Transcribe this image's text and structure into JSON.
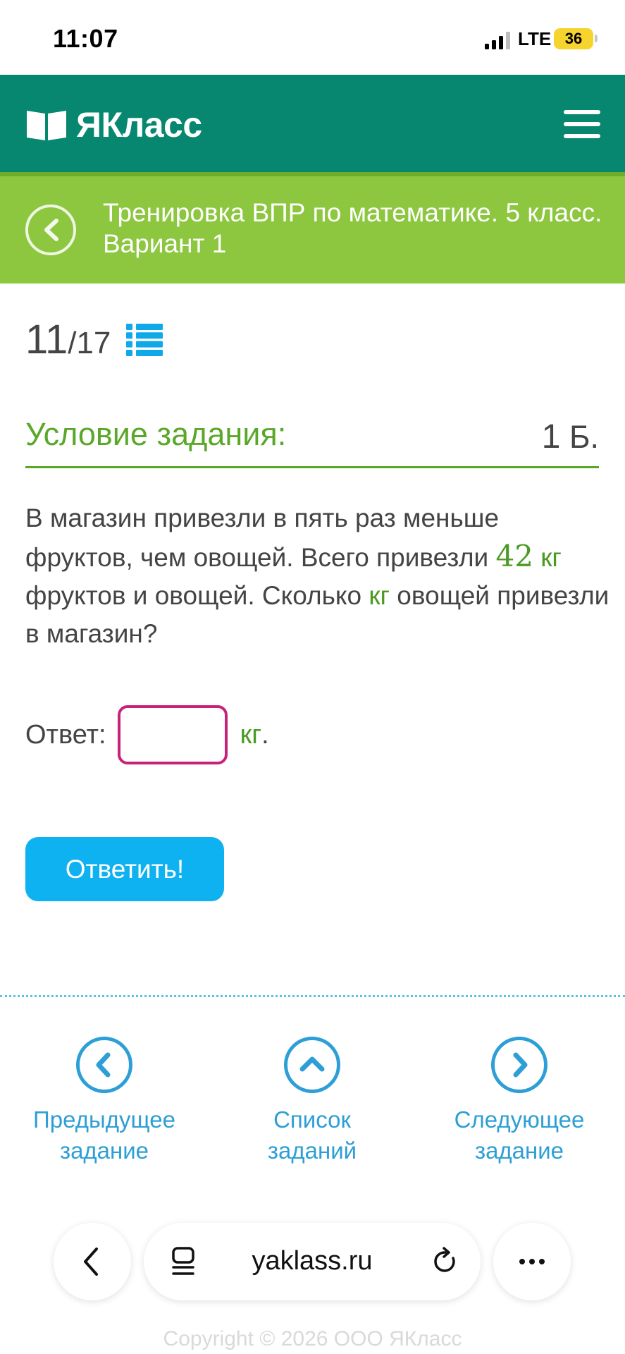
{
  "status_bar": {
    "time": "11:07",
    "network": "LTE",
    "battery": "36",
    "icons": [
      "signal-icon",
      "battery-icon"
    ]
  },
  "header": {
    "brand": "ЯКласс",
    "icons": [
      "book-logo-icon",
      "menu-icon"
    ],
    "color": "#07876f"
  },
  "course": {
    "title": "Тренировка ВПР по математике. 5 класс. Вариант 1",
    "icon": "back-arrow-icon",
    "color": "#8dc63f"
  },
  "counter": {
    "current": "11",
    "total": "/17",
    "icon": "task-list-icon"
  },
  "task": {
    "heading": "Условие задания:",
    "points_value": "1",
    "points_unit": " Б.",
    "text_part1": "В магазин привезли в пять раз меньше фруктов, чем овощей. Всего привезли ",
    "number": "42",
    "unit1": " кг",
    "text_part2": " фруктов и овощей. Сколько ",
    "unit2": "кг",
    "text_part3": " овощей привезли в магазин?"
  },
  "answer": {
    "label": "Ответ:",
    "value": "",
    "unit": "кг",
    "dot": "."
  },
  "submit_label": "Ответить!",
  "nav": {
    "prev": "Предыдущее задание",
    "list": "Список заданий",
    "next": "Следующее задание"
  },
  "browser": {
    "url": "yaklass.ru",
    "icons": [
      "back-icon",
      "tabs-icon",
      "reload-icon",
      "more-icon"
    ]
  },
  "copyright": "Copyright © 2026 ООО ЯКласс",
  "colors": {
    "accent_green": "#5aa82a",
    "button_blue": "#0fb2f0",
    "link_blue": "#2e9fd6",
    "input_border": "#c8217c"
  }
}
